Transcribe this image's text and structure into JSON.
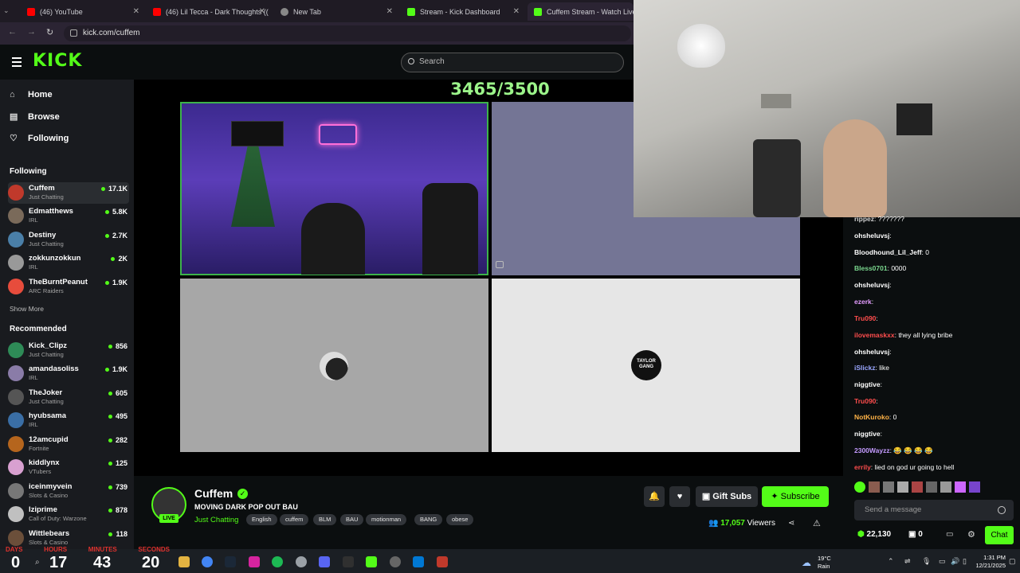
{
  "browser": {
    "tabs": [
      {
        "title": "(46) YouTube"
      },
      {
        "title": "(46) Lil Tecca - Dark Thoughts (("
      },
      {
        "title": "New Tab"
      },
      {
        "title": "Stream - Kick Dashboard"
      },
      {
        "title": "Cuffem Stream - Watch Live"
      }
    ],
    "url": "kick.com/cuffem"
  },
  "header": {
    "logo": "KICK",
    "search_placeholder": "Search"
  },
  "sidebar": {
    "nav": [
      {
        "label": "Home"
      },
      {
        "label": "Browse"
      },
      {
        "label": "Following"
      }
    ],
    "following_title": "Following",
    "following": [
      {
        "name": "Cuffem",
        "category": "Just Chatting",
        "viewers": "17.1K"
      },
      {
        "name": "Edmatthews",
        "category": "IRL",
        "viewers": "5.8K"
      },
      {
        "name": "Destiny",
        "category": "Just Chatting",
        "viewers": "2.7K"
      },
      {
        "name": "zokkunzokkun",
        "category": "IRL",
        "viewers": "2K"
      },
      {
        "name": "TheBurntPeanut",
        "category": "ARC Raiders",
        "viewers": "1.9K"
      }
    ],
    "show_more": "Show More",
    "recommended_title": "Recommended",
    "recommended": [
      {
        "name": "Kick_Clipz",
        "category": "Just Chatting",
        "viewers": "856"
      },
      {
        "name": "amandasoliss",
        "category": "IRL",
        "viewers": "1.9K"
      },
      {
        "name": "TheJoker",
        "category": "Just Chatting",
        "viewers": "605"
      },
      {
        "name": "hyubsama",
        "category": "IRL",
        "viewers": "495"
      },
      {
        "name": "12amcupid",
        "category": "Fortnite",
        "viewers": "282"
      },
      {
        "name": "kiddlynx",
        "category": "VTubers",
        "viewers": "125"
      },
      {
        "name": "iceinmyvein",
        "category": "Slots & Casino",
        "viewers": "739"
      },
      {
        "name": "lziprime",
        "category": "Call of Duty: Warzone",
        "viewers": "878"
      },
      {
        "name": "Wittlebears",
        "category": "Slots & Casino",
        "viewers": "118"
      }
    ]
  },
  "player": {
    "counter": "3465/3500",
    "logo_text": "TAYLOR GANG"
  },
  "stream": {
    "name": "Cuffem",
    "title": "MOVING DARK POP OUT BAU",
    "category": "Just Chatting",
    "live_badge": "LIVE",
    "tags": [
      "English",
      "cuffem",
      "BLM",
      "BAU",
      "motionman",
      "BANG",
      "obese"
    ],
    "viewers_count": "17,057",
    "viewers_label": "Viewers",
    "gift_label": "Gift Subs",
    "subscribe_label": "Subscribe"
  },
  "chat": {
    "messages": [
      {
        "user": "rippez",
        "text": "???????",
        "color": "#d0d0d0"
      },
      {
        "user": "ohsheluvsj",
        "text": "",
        "color": "#ffffff"
      },
      {
        "user": "Bloodhound_Lil_Jeff",
        "text": "0",
        "color": "#ffffff"
      },
      {
        "user": "Bless0701",
        "text": "0000",
        "color": "#7bd88f"
      },
      {
        "user": "ohsheluvsj",
        "text": "",
        "color": "#ffffff"
      },
      {
        "user": "ezerk",
        "text": "",
        "color": "#e49cff"
      },
      {
        "user": "Tru090",
        "text": "",
        "color": "#ff4d4d"
      },
      {
        "user": "ilovemaskxx",
        "text": "they all lying bribe",
        "color": "#ff4d4d"
      },
      {
        "user": "ohsheluvsj",
        "text": "",
        "color": "#ffffff"
      },
      {
        "user": "iSlickz",
        "text": "like",
        "color": "#9aa6ff"
      },
      {
        "user": "niggtive",
        "text": "",
        "color": "#ffffff"
      },
      {
        "user": "Tru090",
        "text": "",
        "color": "#ff4d4d"
      },
      {
        "user": "NotKuroko",
        "text": "0",
        "color": "#ffb347"
      },
      {
        "user": "niggtive",
        "text": "",
        "color": "#ffffff"
      },
      {
        "user": "2300Wayzz",
        "text": "😂 😂 😂 😂",
        "color": "#c49bff"
      },
      {
        "user": "errily",
        "text": "lied on god ur going to hell",
        "color": "#ff4d4d"
      }
    ],
    "input_placeholder": "Send a message",
    "points": "22,130",
    "gifts": "0",
    "chat_button": "Chat"
  },
  "overlay": {
    "days": "0",
    "hours": "17",
    "minutes": "43",
    "seconds": "20",
    "labels": [
      "DAYS",
      "HOURS",
      "MINUTES",
      "SECONDS"
    ]
  },
  "taskbar": {
    "weather_temp": "19°C",
    "weather_desc": "Rain",
    "time": "1:31 PM",
    "date": "12/21/2025"
  },
  "colors": {
    "accent": "#53fc18",
    "bg": "#0b0e0f",
    "sidebar": "#191b1f"
  }
}
